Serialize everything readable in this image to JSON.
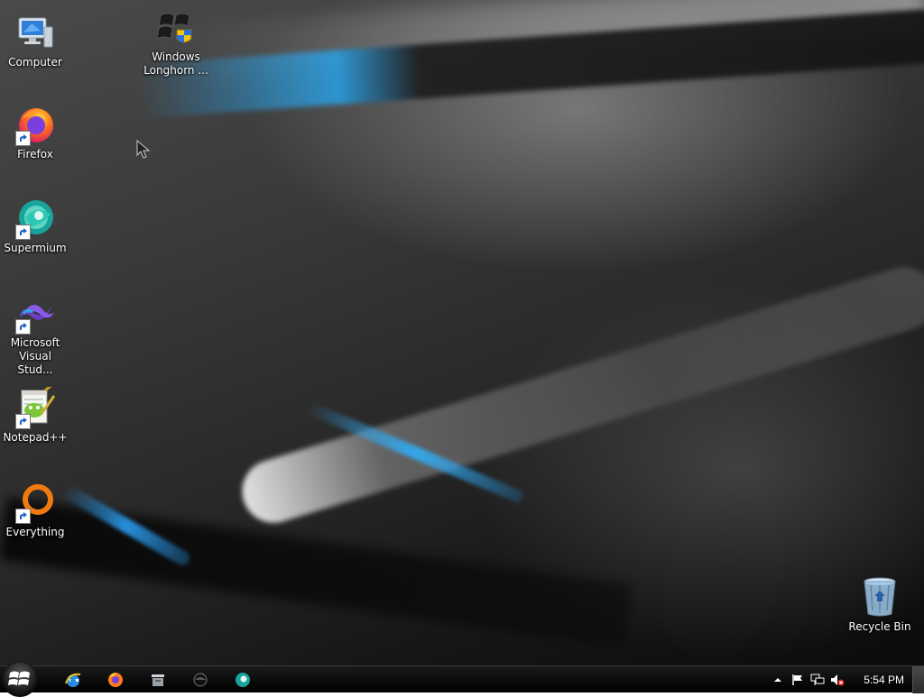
{
  "desktop": {
    "icons": [
      {
        "label": "Computer",
        "icon": "computer-icon"
      },
      {
        "label": "Windows\nLonghorn ...",
        "icon": "windows-logo-icon"
      },
      {
        "label": "Firefox",
        "icon": "firefox-icon"
      },
      {
        "label": "Supermium",
        "icon": "supermium-icon"
      },
      {
        "label": "Microsoft\nVisual Stud...",
        "icon": "visual-studio-icon"
      },
      {
        "label": "Notepad++",
        "icon": "notepadpp-icon"
      },
      {
        "label": "Everything",
        "icon": "everything-icon"
      },
      {
        "label": "Recycle Bin",
        "icon": "recycle-bin-icon"
      }
    ]
  },
  "taskbar": {
    "start_icon": "windows-start-orb",
    "pinned": [
      {
        "icon": "internet-explorer-icon"
      },
      {
        "icon": "firefox-icon"
      },
      {
        "icon": "file-explorer-icon"
      },
      {
        "icon": "media-player-icon"
      },
      {
        "icon": "supermium-icon"
      }
    ],
    "tray": {
      "icons": [
        "show-hidden-icons-chevron",
        "action-center-flag-icon",
        "network-icon",
        "volume-muted-icon"
      ],
      "clock": "5:54 PM"
    }
  },
  "colors": {
    "accent_blue": "#2d9ae0",
    "taskbar": "#0c0c0c",
    "label_text": "#ffffff"
  }
}
